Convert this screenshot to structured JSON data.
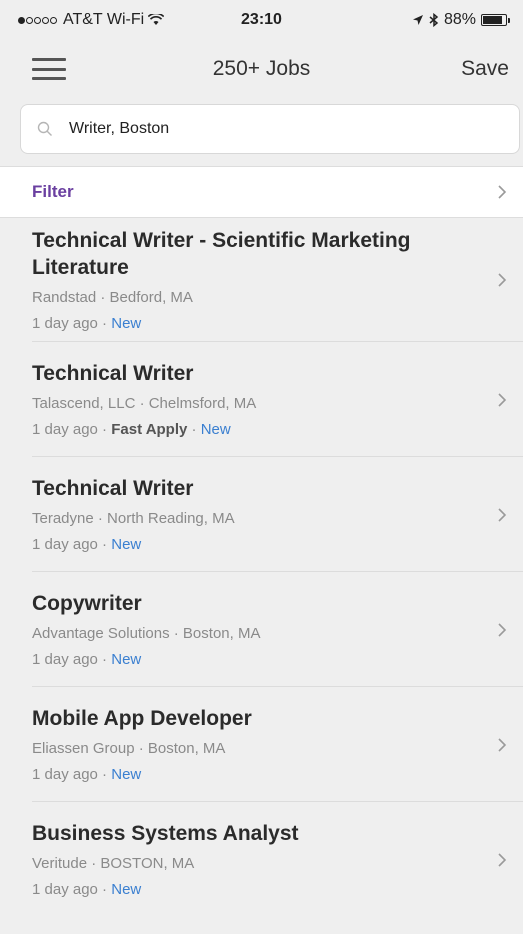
{
  "status_bar": {
    "carrier": "AT&T Wi-Fi",
    "time": "23:10",
    "battery": "88%",
    "battery_level": 0.88
  },
  "nav": {
    "title": "250+ Jobs",
    "save_label": "Save"
  },
  "search": {
    "value": "Writer, Boston"
  },
  "filter": {
    "label": "Filter"
  },
  "jobs": [
    {
      "title": "Technical Writer - Scientific Marketing Literature",
      "company_location": "Randstad · Bedford, MA",
      "posted": "1 day ago",
      "fast_apply": "",
      "badge": "New"
    },
    {
      "title": "Technical Writer",
      "company_location": "Talascend, LLC · Chelmsford, MA",
      "posted": "1 day ago",
      "fast_apply": "Fast Apply",
      "badge": "New"
    },
    {
      "title": "Technical Writer",
      "company_location": "Teradyne · North Reading, MA",
      "posted": "1 day ago",
      "fast_apply": "",
      "badge": "New"
    },
    {
      "title": "Copywriter",
      "company_location": "Advantage Solutions · Boston, MA",
      "posted": "1 day ago",
      "fast_apply": "",
      "badge": "New"
    },
    {
      "title": "Mobile App Developer",
      "company_location": "Eliassen Group · Boston, MA",
      "posted": "1 day ago",
      "fast_apply": "",
      "badge": "New"
    },
    {
      "title": "Business Systems Analyst",
      "company_location": "Veritude · BOSTON, MA",
      "posted": "1 day ago",
      "fast_apply": "",
      "badge": "New"
    }
  ],
  "colors": {
    "filter_accent": "#6a3fa0",
    "new_badge": "#3a7fd0"
  }
}
